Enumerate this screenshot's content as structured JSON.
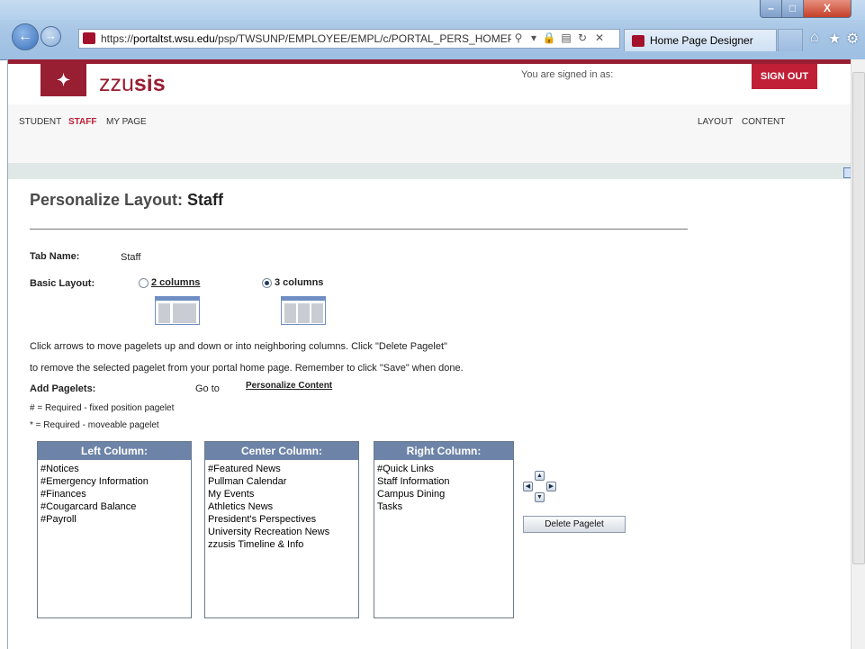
{
  "browser": {
    "url": "https://portaltst.wsu.edu/psp/TWSUNP/EMPLOYEE/EMPL/c/PORTAL_PERS_HOMEPAGE.P(",
    "url_host": "portaltst.wsu.edu",
    "url_prefix": "https://",
    "url_path": "/psp/TWSUNP/EMPLOYEE/EMPL/c/PORTAL_PERS_HOMEPAGE.P(",
    "tab_title": "Home Page Designer",
    "window_controls": {
      "minimize": "–",
      "maximize": "□",
      "close": "X"
    }
  },
  "header": {
    "logo_text_light": "zzu",
    "logo_text_bold": "sis",
    "signed_in_text": "You are signed in as:",
    "sign_out_label": "SIGN OUT"
  },
  "nav": {
    "left": [
      "STUDENT",
      "STAFF",
      "MY PAGE"
    ],
    "right": [
      "LAYOUT",
      "CONTENT"
    ]
  },
  "page": {
    "title_prefix": "Personalize Layout: ",
    "title_tab": "Staff",
    "tab_name_label": "Tab Name:",
    "tab_name_value": "Staff",
    "basic_layout_label": "Basic Layout:",
    "layout_options": [
      {
        "label": "2 columns",
        "selected": false
      },
      {
        "label": "3 columns",
        "selected": true
      }
    ],
    "instructions_line1": "Click arrows to move pagelets up and down or into neighboring columns. Click \"Delete Pagelet\"",
    "instructions_line2": "to remove the selected pagelet from your portal home page. Remember to click \"Save\" when done.",
    "add_pagelets_label": "Add Pagelets:",
    "go_to_label": "Go to",
    "personalize_content_link": "Personalize Content",
    "legend_fixed": "# = Required - fixed position pagelet",
    "legend_moveable": "* = Required - moveable pagelet",
    "delete_button": "Delete Pagelet"
  },
  "columns": [
    {
      "header": "Left Column:",
      "items": [
        "#Notices",
        "#Emergency Information",
        "#Finances",
        "#Cougarcard Balance",
        "#Payroll"
      ]
    },
    {
      "header": "Center Column:",
      "items": [
        "#Featured News",
        "Pullman Calendar",
        "My Events",
        "Athletics News",
        "President's Perspectives",
        "University Recreation News",
        "zzusis Timeline & Info"
      ]
    },
    {
      "header": "Right Column:",
      "items": [
        "#Quick Links",
        "Staff Information",
        "Campus Dining",
        "Tasks"
      ]
    }
  ]
}
